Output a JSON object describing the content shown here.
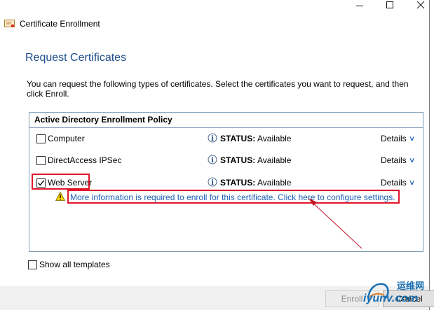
{
  "window": {
    "title": "Certificate Enrollment",
    "controls": {
      "minimize": "minimize",
      "maximize": "maximize",
      "close": "close"
    }
  },
  "page": {
    "heading": "Request Certificates",
    "description": "You can request the following types of certificates. Select the certificates you want to request, and then click Enroll."
  },
  "policy": {
    "header": "Active Directory Enrollment Policy",
    "items": [
      {
        "name": "Computer",
        "checked": false,
        "status_label": "STATUS:",
        "status": "Available",
        "details": "Details"
      },
      {
        "name": "DirectAccess IPSec",
        "checked": false,
        "status_label": "STATUS:",
        "status": "Available",
        "details": "Details"
      },
      {
        "name": "Web Server",
        "checked": true,
        "status_label": "STATUS:",
        "status": "Available",
        "details": "Details"
      }
    ],
    "more_info_link": "More information is required to enroll for this certificate. Click here to configure settings."
  },
  "options": {
    "show_all_templates": "Show all templates",
    "show_all_checked": false
  },
  "buttons": {
    "enroll": "Enroll",
    "cancel": "Cancel"
  },
  "watermark": {
    "cn": "运维网",
    "en": "iyunv.com"
  },
  "colors": {
    "heading": "#1e4e8c",
    "link": "#1e5fb4",
    "highlight": "#e0162b",
    "border": "#7f9db9"
  }
}
